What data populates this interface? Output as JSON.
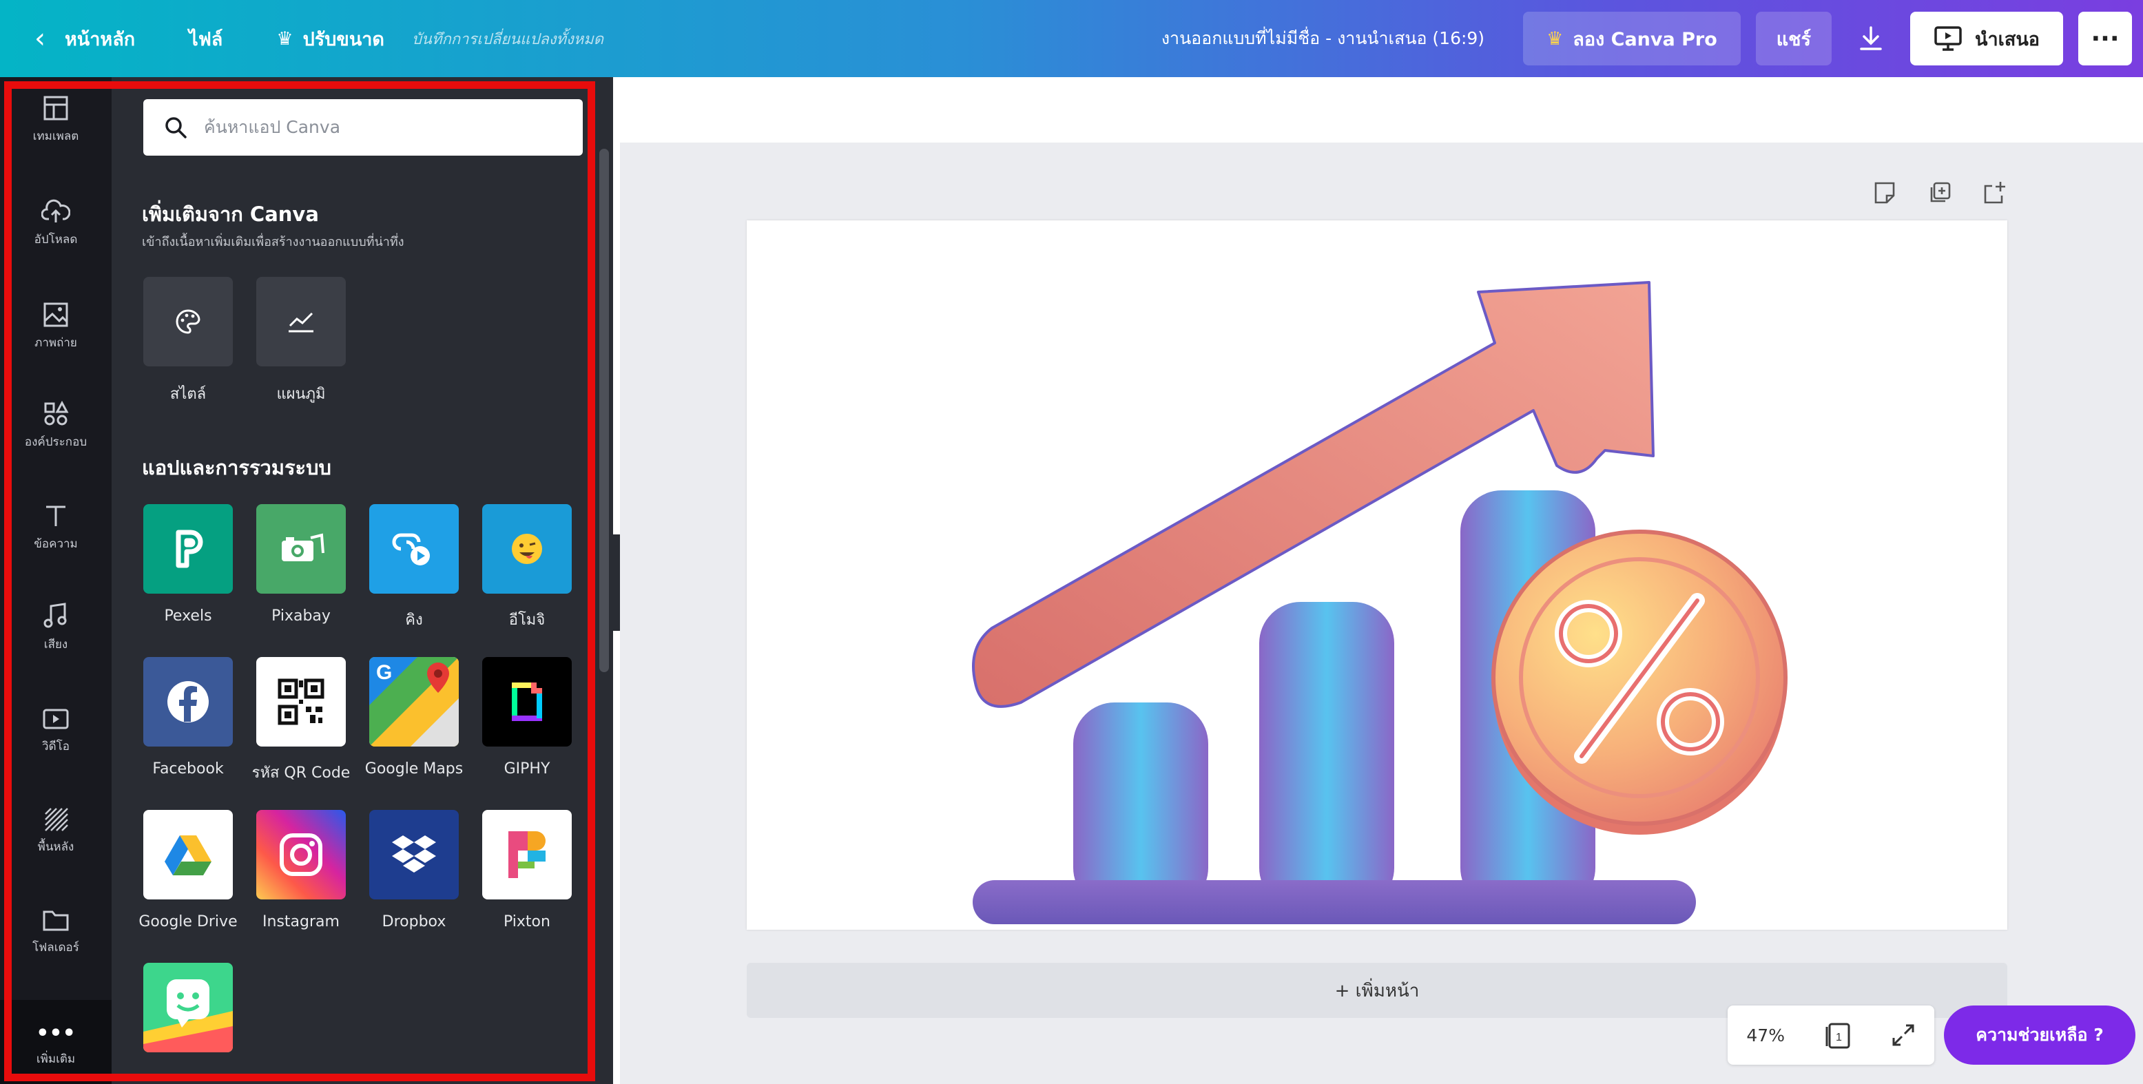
{
  "topbar": {
    "back_label": "หน้าหลัก",
    "file_label": "ไฟล์",
    "resize_label": "ปรับขนาด",
    "saved_status": "บันทึกการเปลี่ยนแปลงทั้งหมด",
    "doc_title": "งานออกแบบที่ไม่มีชื่อ - งานนำเสนอ (16:9)",
    "pro_label": "ลอง Canva Pro",
    "share_label": "แชร์",
    "present_label": "นำเสนอ",
    "more_label": "···"
  },
  "rail": {
    "items": [
      {
        "label": "เทมเพลต",
        "icon": "template-icon"
      },
      {
        "label": "อัปโหลด",
        "icon": "upload-icon"
      },
      {
        "label": "ภาพถ่าย",
        "icon": "photo-icon"
      },
      {
        "label": "องค์ประกอบ",
        "icon": "elements-icon"
      },
      {
        "label": "ข้อความ",
        "icon": "text-icon"
      },
      {
        "label": "เสียง",
        "icon": "music-icon"
      },
      {
        "label": "วิดีโอ",
        "icon": "video-icon"
      },
      {
        "label": "พื้นหลัง",
        "icon": "background-icon"
      },
      {
        "label": "โฟลเดอร์",
        "icon": "folder-icon"
      },
      {
        "label": "เพิ่มเติม",
        "icon": "more-icon"
      }
    ]
  },
  "panel": {
    "search_placeholder": "ค้นหาแอป Canva",
    "from_canva_title": "เพิ่มเติมจาก Canva",
    "from_canva_sub": "เข้าถึงเนื้อหาเพิ่มเติมเพื่อสร้างงานออกแบบที่น่าทึ่ง",
    "from_canva_items": [
      {
        "label": "สไตล์",
        "icon": "palette-icon"
      },
      {
        "label": "แผนภูมิ",
        "icon": "chart-icon"
      }
    ],
    "apps_title": "แอปและการรวมระบบ",
    "apps": [
      {
        "label": "Pexels",
        "color": "#05a081",
        "icon": "pexels-icon"
      },
      {
        "label": "Pixabay",
        "color": "#48a868",
        "icon": "pixabay-icon"
      },
      {
        "label": "คิง",
        "color": "#1fa0e6",
        "icon": "link-play-icon"
      },
      {
        "label": "อีโมจิ",
        "color": "#1a9bd7",
        "icon": "emoji-icon"
      },
      {
        "label": "Facebook",
        "color": "#3b5998",
        "icon": "facebook-icon"
      },
      {
        "label": "รหัส QR Code",
        "color": "#ffffff",
        "icon": "qr-code-icon"
      },
      {
        "label": "Google Maps",
        "color": "#4caf50",
        "icon": "google-maps-icon"
      },
      {
        "label": "GIPHY",
        "color": "#000000",
        "icon": "giphy-icon"
      },
      {
        "label": "Google Drive",
        "color": "#ffffff",
        "icon": "google-drive-icon"
      },
      {
        "label": "Instagram",
        "color": "#d6249f",
        "icon": "instagram-icon"
      },
      {
        "label": "Dropbox",
        "color": "#1e3d8f",
        "icon": "dropbox-icon"
      },
      {
        "label": "Pixton",
        "color": "#ffffff",
        "icon": "pixton-icon"
      },
      {
        "label": "",
        "color": "#3dd68c",
        "icon": "bitmoji-icon"
      }
    ]
  },
  "canvas": {
    "add_page_label": "+ เพิ่มหน้า",
    "zoom": "47%",
    "page_count": "1",
    "help_label": "ความช่วยเหลือ ?"
  },
  "colors": {
    "highlight": "#e80c0c",
    "accent": "#7d2ae8"
  }
}
